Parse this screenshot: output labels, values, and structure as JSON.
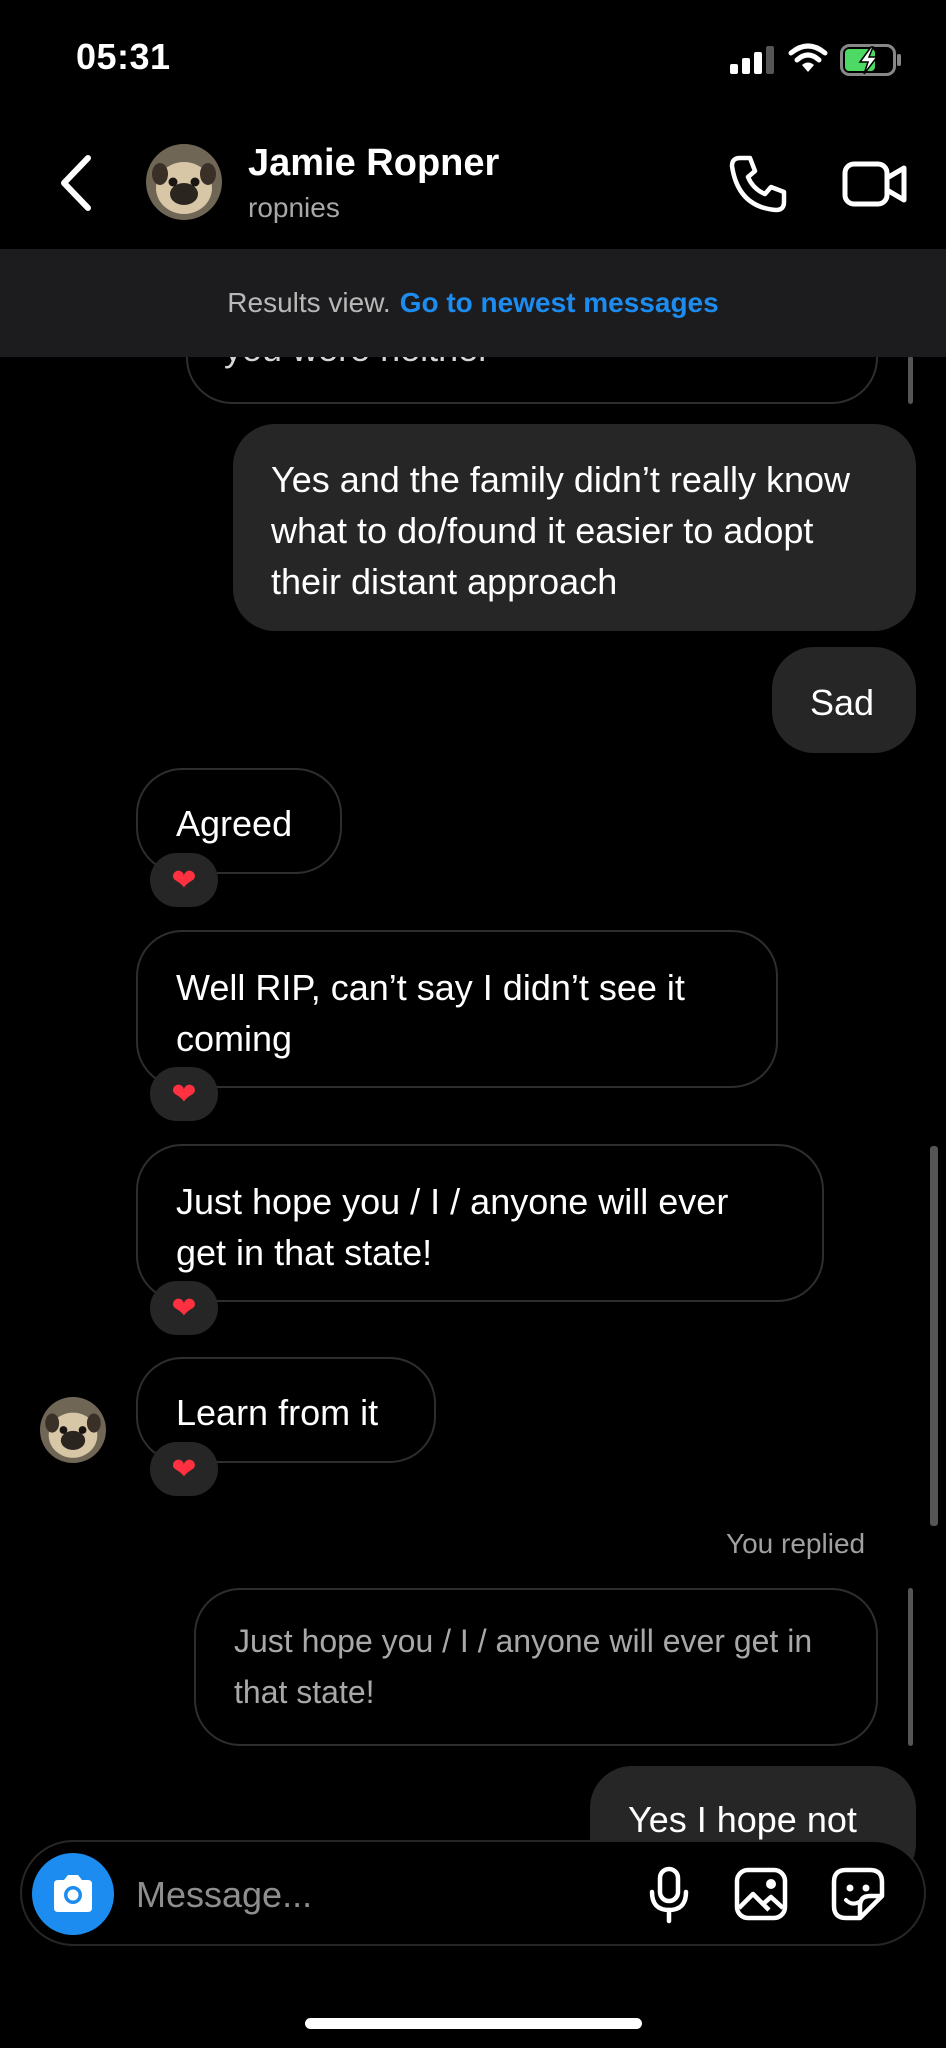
{
  "status_bar": {
    "time": "05:31"
  },
  "header": {
    "name": "Jamie Ropner",
    "username": "ropnies"
  },
  "banner": {
    "prefix": "Results view.",
    "link": "Go to newest messages"
  },
  "messages": {
    "top_cut": "you were neither",
    "yes_family": "Yes and the family didn’t really know what to do/found it easier to adopt their distant approach",
    "sad": "Sad",
    "agreed": "Agreed",
    "rip": "Well RIP, can’t say I didn’t see it coming",
    "hope": "Just hope you / I / anyone will ever get in that state!",
    "learn": "Learn from it",
    "reaction_emoji": "❤️",
    "you_replied": "You replied",
    "quoted": "Just hope you / I / anyone will ever get in that state!",
    "hope_not": "Yes I hope not"
  },
  "composer": {
    "placeholder": "Message..."
  },
  "colors": {
    "accent": "#1d8cf0",
    "sent_bubble": "#262626",
    "background": "#000000",
    "battery_green": "#4cd964"
  }
}
